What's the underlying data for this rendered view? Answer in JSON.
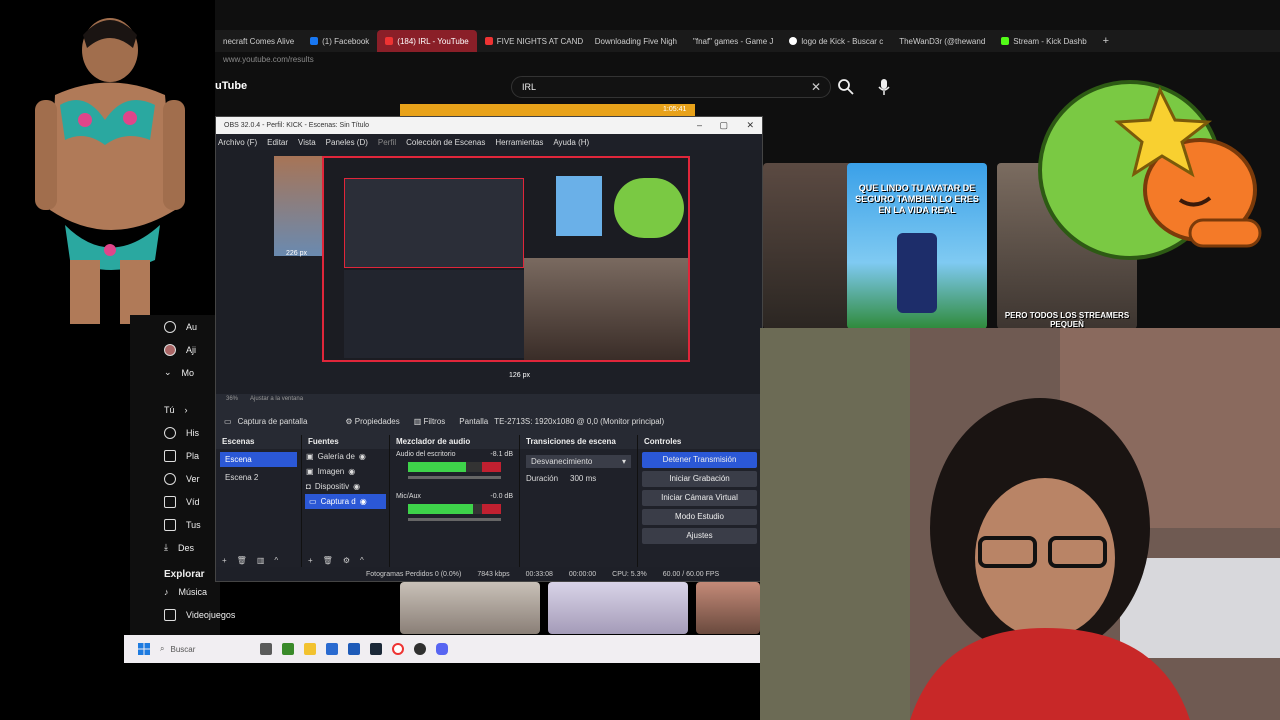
{
  "browser": {
    "tabs": [
      {
        "label": "necraft Comes Alive"
      },
      {
        "label": "(1) Facebook"
      },
      {
        "label": "(184) IRL - YouTube"
      },
      {
        "label": "FIVE NIGHTS AT CAND"
      },
      {
        "label": "Downloading Five Nigh"
      },
      {
        "label": "\"fnaf\" games - Game J"
      },
      {
        "label": "logo de Kick - Buscar c"
      },
      {
        "label": "TheWanD3r (@thewand"
      },
      {
        "label": "Stream - Kick Dashb"
      }
    ],
    "url": "www.youtube.com/results",
    "logo": "uTube",
    "search_value": "IRL",
    "thumb_texts": [
      "QUE LINDO TU AVATAR DE SEGURO TAMBIEN LO ERES EN LA VIDA REAL",
      "PERO TODOS LOS STREAMERS PEQUEÑ"
    ],
    "video_time": "1:05:41"
  },
  "yt_sidebar": {
    "items": [
      {
        "label": "Au",
        "icon": "avatar-icon"
      },
      {
        "label": "Aji",
        "icon": "avatar-icon"
      },
      {
        "label": "Mo",
        "icon": "chevron-down-icon"
      },
      {
        "label": "Tú",
        "icon": "chevron-right-icon"
      },
      {
        "label": "His",
        "icon": "history-icon"
      },
      {
        "label": "Pla",
        "icon": "playlist-icon"
      },
      {
        "label": "Ver",
        "icon": "clock-icon"
      },
      {
        "label": "Víd",
        "icon": "like-icon"
      },
      {
        "label": "Tus",
        "icon": "video-icon"
      },
      {
        "label": "Des",
        "icon": "download-icon"
      }
    ],
    "explore": "Explorar",
    "music": "Música",
    "videogames": "Videojuegos"
  },
  "obs": {
    "title": "OBS 32.0.4 - Perfil: KICK - Escenas: Sin Título",
    "menu": [
      "Archivo (F)",
      "Editar",
      "Vista",
      "Paneles (D)",
      "Perfil",
      "Colección de Escenas",
      "Herramientas",
      "Ayuda (H)"
    ],
    "px_top": "226 px",
    "px_bottom": "126 px",
    "zoom": "36%",
    "fit": "Ajustar a la ventana",
    "source_bar": {
      "name": "Captura de pantalla",
      "props": "Propiedades",
      "filters": "Filtros",
      "display_label": "Pantalla",
      "display_value": "TE-2713S: 1920x1080 @ 0,0 (Monitor principal)"
    },
    "scenes": {
      "title": "Escenas",
      "items": [
        "Escena",
        "Escena 2"
      ],
      "selected": 0
    },
    "sources": {
      "title": "Fuentes",
      "items": [
        "Galería de",
        "Imagen",
        "Dispositiv",
        "Captura d"
      ],
      "selected": 3
    },
    "mixer": {
      "title": "Mezclador de audio",
      "ch1": "Audio del escritorio",
      "ch1_db": "-8.1 dB",
      "ch2": "Mic/Aux",
      "ch2_db": "-0.0 dB",
      "ch1_level": 0.62,
      "ch2_level": 0.7
    },
    "transitions": {
      "title": "Transiciones de escena",
      "type": "Desvanecimiento",
      "duration_label": "Duración",
      "duration": "300 ms"
    },
    "controls": {
      "title": "Controles",
      "stop": "Detener Transmisión",
      "record": "Iniciar Grabación",
      "vcam": "Iniciar Cámara Virtual",
      "studio": "Modo Estudio",
      "settings": "Ajustes"
    },
    "status": {
      "dropped": "Fotogramas Perdidos 0 (0.0%)",
      "bitrate": "7843 kbps",
      "live_time": "00:33:08",
      "rec_time": "00:00:00",
      "cpu": "CPU: 5.3%",
      "fps": "60.00 / 60.00 FPS"
    }
  },
  "taskbar": {
    "search": "Buscar"
  }
}
